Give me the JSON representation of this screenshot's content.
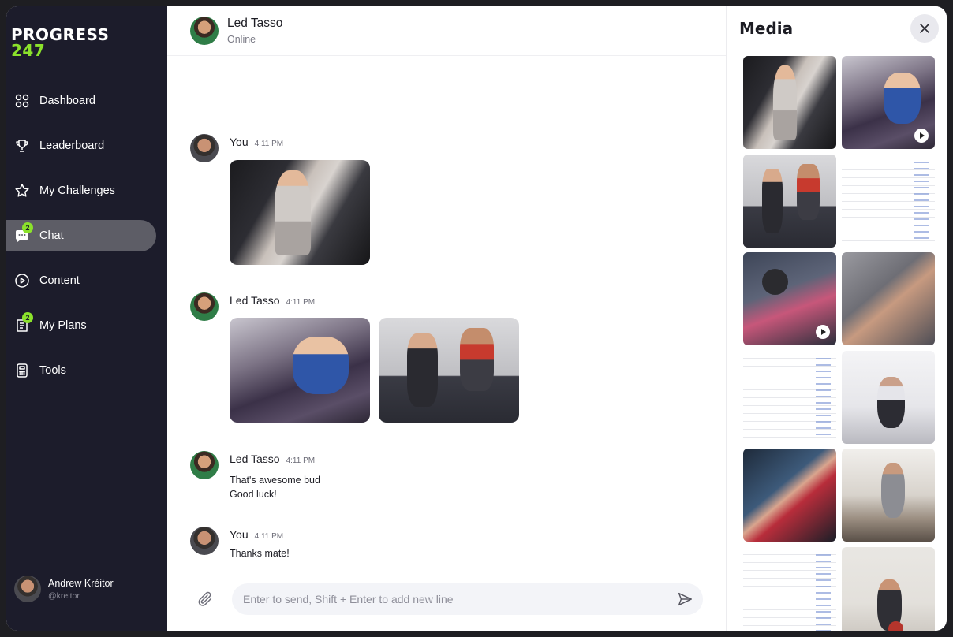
{
  "logo": {
    "line1": "PROGRESS",
    "line2": "247"
  },
  "nav": [
    {
      "label": "Dashboard",
      "icon": "grid-icon",
      "badge": ""
    },
    {
      "label": "Leaderboard",
      "icon": "trophy-icon",
      "badge": ""
    },
    {
      "label": "My Challenges",
      "icon": "star-icon",
      "badge": ""
    },
    {
      "label": "Chat",
      "icon": "chat-icon",
      "badge": "2",
      "active": true
    },
    {
      "label": "Content",
      "icon": "play-circle-icon",
      "badge": ""
    },
    {
      "label": "My Plans",
      "icon": "document-icon",
      "badge": "2"
    },
    {
      "label": "Tools",
      "icon": "calculator-icon",
      "badge": ""
    }
  ],
  "profile": {
    "name": "Andrew Kréitor",
    "handle": "@kreitor"
  },
  "header": {
    "name": "Led Tasso",
    "status": "Online"
  },
  "messages": [
    {
      "who": "You",
      "time": "4:11 PM"
    },
    {
      "who": "Led Tasso",
      "time": "4:11 PM"
    },
    {
      "who": "Led Tasso",
      "time": "4:11 PM",
      "line1": "That's awesome bud",
      "line2": "Good luck!"
    },
    {
      "who": "You",
      "time": "4:11 PM",
      "line1": "Thanks mate!"
    }
  ],
  "composer": {
    "placeholder": "Enter to send, Shift + Enter to add new line"
  },
  "media": {
    "title": "Media"
  },
  "colors": {
    "accent": "#8be22b",
    "sidebar": "#1c1c2b",
    "active": "#5d5d66"
  }
}
